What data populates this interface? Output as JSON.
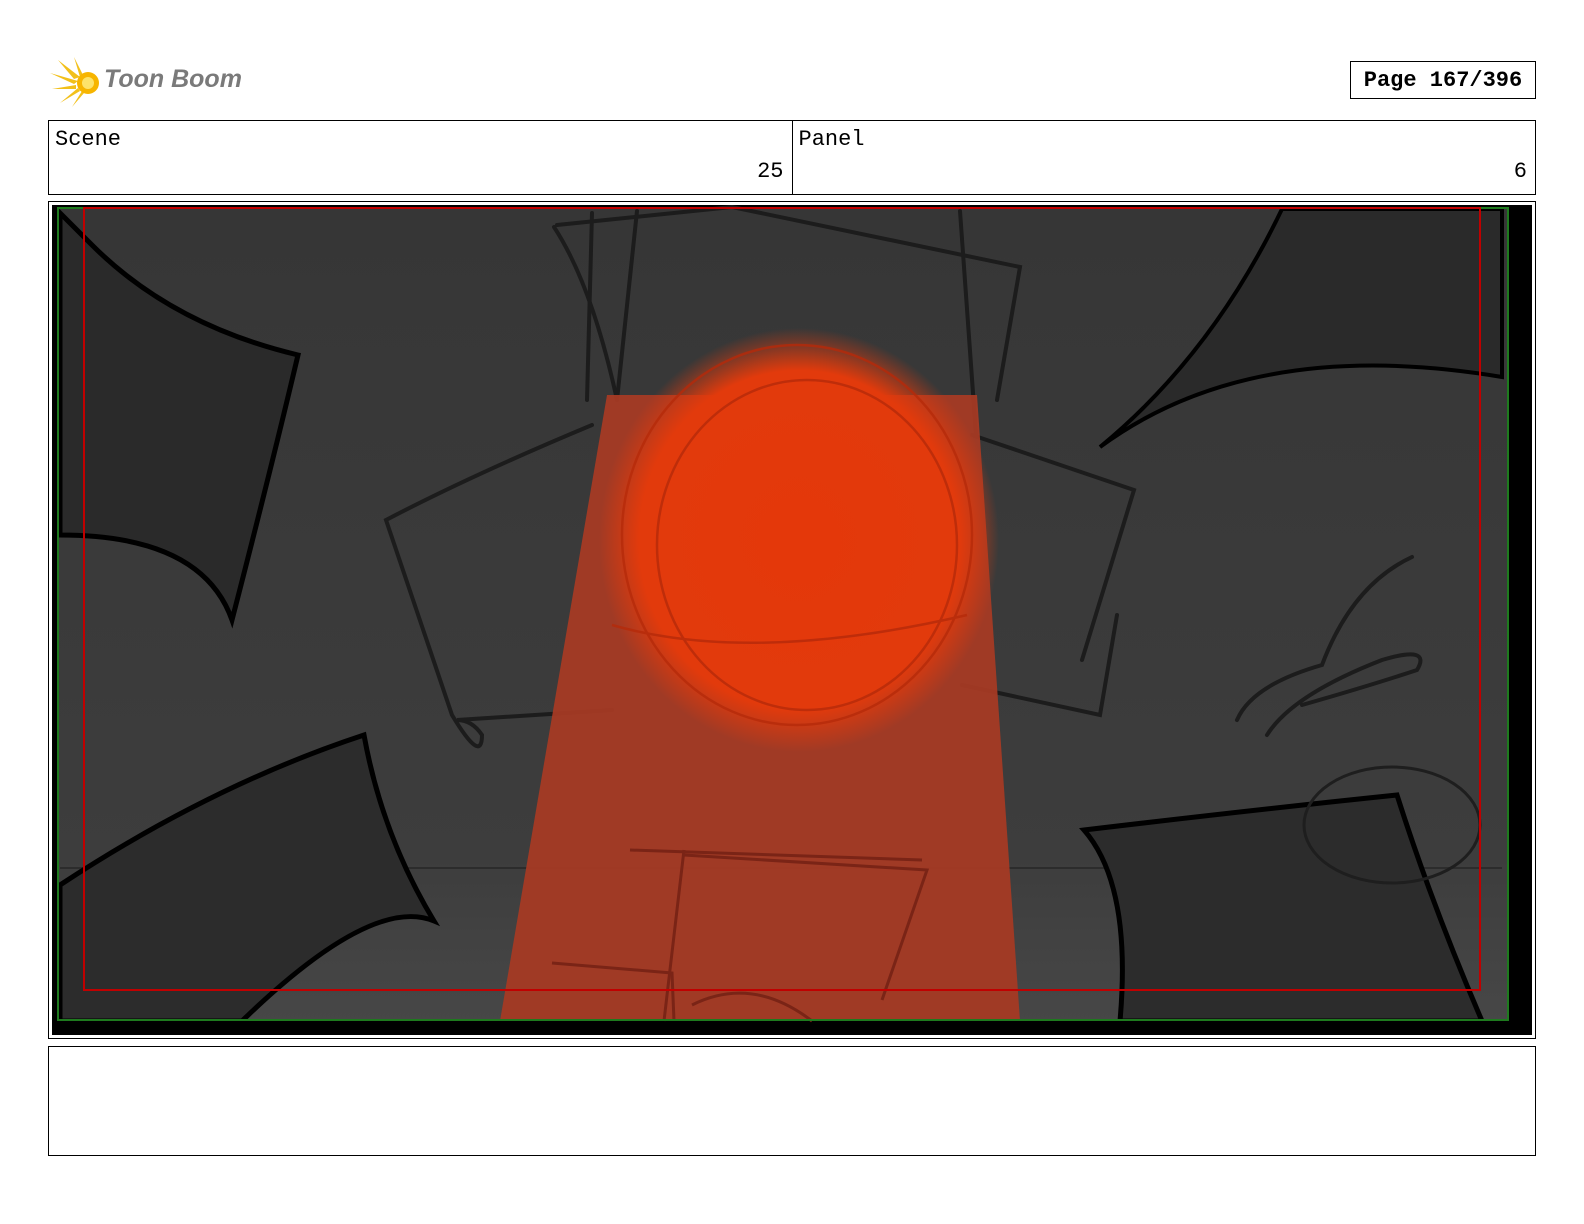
{
  "header": {
    "logo": {
      "brand": "Toon Boom",
      "icon": "starburst-logo-icon"
    },
    "page_indicator": "Page 167/396"
  },
  "info": {
    "scene": {
      "label": "Scene",
      "value": "25"
    },
    "panel": {
      "label": "Panel",
      "value": "6"
    }
  },
  "panel_image": {
    "description_icon": "storyboard-sketch",
    "colors": {
      "background": "#3a3a3a",
      "shadow_shape": "#2a2a2a",
      "glow": "#e23a0c",
      "beam": "#a53a24",
      "safe_frame": "#c00000",
      "outer_frame": "#1e7a1e"
    }
  },
  "notes": {
    "text": ""
  }
}
